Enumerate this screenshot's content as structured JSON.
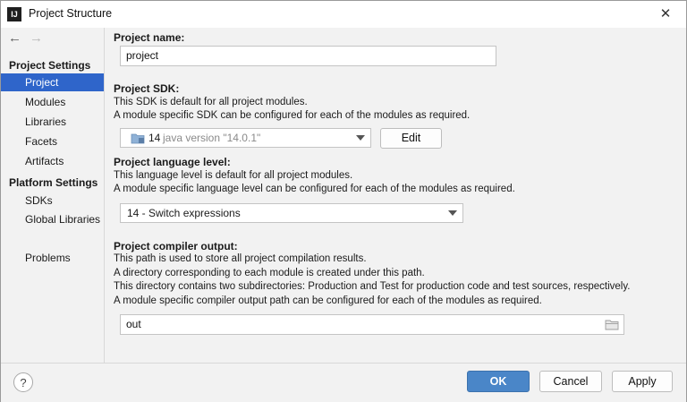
{
  "window": {
    "title": "Project Structure",
    "app_icon_text": "IJ"
  },
  "sidebar": {
    "project_settings_header": "Project Settings",
    "platform_settings_header": "Platform Settings",
    "items": [
      {
        "label": "Project"
      },
      {
        "label": "Modules"
      },
      {
        "label": "Libraries"
      },
      {
        "label": "Facets"
      },
      {
        "label": "Artifacts"
      },
      {
        "label": "SDKs"
      },
      {
        "label": "Global Libraries"
      },
      {
        "label": "Problems"
      }
    ],
    "selected": "Project"
  },
  "project_name": {
    "label": "Project name:",
    "value": "project"
  },
  "project_sdk": {
    "label": "Project SDK:",
    "desc1": "This SDK is default for all project modules.",
    "desc2": "A module specific SDK can be configured for each of the modules as required.",
    "sdk_number": "14",
    "sdk_version": "java version \"14.0.1\"",
    "edit_label": "Edit"
  },
  "language_level": {
    "label": "Project language level:",
    "desc1": "This language level is default for all project modules.",
    "desc2": "A module specific language level can be configured for each of the modules as required.",
    "selected": "14 - Switch expressions"
  },
  "compiler_output": {
    "label": "Project compiler output:",
    "desc1": "This path is used to store all project compilation results.",
    "desc2": "A directory corresponding to each module is created under this path.",
    "desc3": "This directory contains two subdirectories: Production and Test for production code and test sources, respectively.",
    "desc4": "A module specific compiler output path can be configured for each of the modules as required.",
    "value": "out"
  },
  "footer": {
    "help": "?",
    "ok": "OK",
    "cancel": "Cancel",
    "apply": "Apply"
  },
  "colors": {
    "selection": "#2f65ca",
    "primary_button": "#4a86c8"
  },
  "icons": [
    "app-icon",
    "close-icon",
    "back-arrow-icon",
    "forward-arrow-icon",
    "sdk-folder-icon",
    "folder-browse-icon",
    "help-icon",
    "chevron-down-icon"
  ]
}
